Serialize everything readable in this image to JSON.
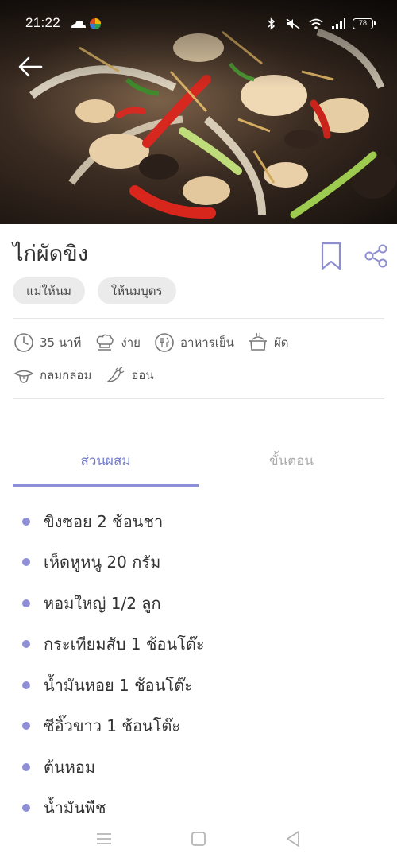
{
  "status_bar": {
    "time": "21:22",
    "battery": "78"
  },
  "recipe": {
    "title": "ไก่ผัดขิง",
    "tags": [
      "แม่ให้นม",
      "ให้นมบุตร"
    ],
    "meta": {
      "time": "35 นาที",
      "difficulty": "ง่าย",
      "temperature": "อาหารเย็น",
      "method": "ผัด",
      "taste": "กลมกล่อม",
      "texture": "อ่อน"
    }
  },
  "tabs": {
    "ingredients": "ส่วนผสม",
    "steps": "ขั้นตอน"
  },
  "ingredients": [
    "ขิงซอย 2 ช้อนชา",
    "เห็ดหูหนู 20 กรัม",
    "หอมใหญ่ 1/2 ลูก",
    "กระเทียมสับ 1 ช้อนโต๊ะ",
    "น้ำมันหอย 1 ช้อนโต๊ะ",
    "ซีอิ๊วขาว 1 ช้อนโต๊ะ",
    "ต้นหอม",
    "น้ำมันพืช"
  ],
  "colors": {
    "accent": "#8a8fd8",
    "accent_text": "#6f78c9",
    "bullet": "#8e8fd6",
    "tag_bg": "#ebebeb"
  },
  "icons": {
    "back": "arrow-left-icon",
    "bookmark": "bookmark-icon",
    "share": "share-icon",
    "time": "clock-icon",
    "difficulty": "chef-hat-icon",
    "temperature": "utensils-icon",
    "method": "pot-icon",
    "taste": "tongue-icon",
    "texture": "chili-icon"
  }
}
